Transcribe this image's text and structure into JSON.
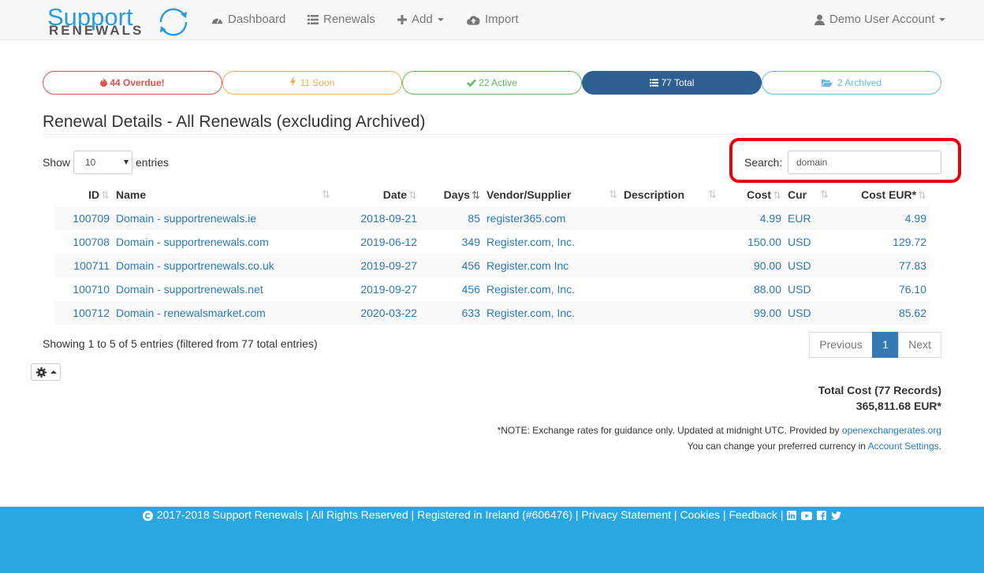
{
  "brand": {
    "line1": "Support",
    "line2": "RENEWALS"
  },
  "nav": {
    "dashboard": "Dashboard",
    "renewals": "Renewals",
    "add": "Add",
    "import": "Import",
    "account": "Demo User Account"
  },
  "status_tabs": {
    "overdue": "44 Overdue!",
    "soon": "11 Soon",
    "active": "22 Active",
    "total": "77 Total",
    "archived": "2 Archived"
  },
  "colors": {
    "overdue": "#d9534f",
    "soon": "#f0ad4e",
    "active": "#5cb85c",
    "total": "#2d5f91",
    "archived": "#5bc0de",
    "footer": "#29a8e0"
  },
  "page_title": "Renewal Details - All Renewals (excluding Archived)",
  "length": {
    "show": "Show",
    "value": "10",
    "entries": "entries"
  },
  "search": {
    "label": "Search:",
    "value": "domain"
  },
  "table": {
    "headers": {
      "id": "ID",
      "name": "Name",
      "date": "Date",
      "days": "Days",
      "vendor": "Vendor/Supplier",
      "description": "Description",
      "cost": "Cost",
      "cur": "Cur",
      "cost_eur": "Cost EUR*"
    },
    "rows": [
      {
        "id": "100709",
        "name": "Domain - supportrenewals.ie",
        "date": "2018-09-21",
        "days": "85",
        "vendor": "register365.com",
        "description": "",
        "cost": "4.99",
        "cur": "EUR",
        "cost_eur": "4.99"
      },
      {
        "id": "100708",
        "name": "Domain - supportrenewals.com",
        "date": "2019-06-12",
        "days": "349",
        "vendor": "Register.com, Inc.",
        "description": "",
        "cost": "150.00",
        "cur": "USD",
        "cost_eur": "129.72"
      },
      {
        "id": "100711",
        "name": "Domain - supportrenewals.co.uk",
        "date": "2019-09-27",
        "days": "456",
        "vendor": "Register.com Inc",
        "description": "",
        "cost": "90.00",
        "cur": "USD",
        "cost_eur": "77.83"
      },
      {
        "id": "100710",
        "name": "Domain - supportrenewals.net",
        "date": "2019-09-27",
        "days": "456",
        "vendor": "Register.com, Inc.",
        "description": "",
        "cost": "88.00",
        "cur": "USD",
        "cost_eur": "76.10"
      },
      {
        "id": "100712",
        "name": "Domain - renewalsmarket.com",
        "date": "2020-03-22",
        "days": "633",
        "vendor": "Register.com, Inc.",
        "description": "",
        "cost": "99.00",
        "cur": "USD",
        "cost_eur": "85.62"
      }
    ]
  },
  "info": "Showing 1 to 5 of 5 entries (filtered from 77 total entries)",
  "pagination": {
    "previous": "Previous",
    "page": "1",
    "next": "Next"
  },
  "totals": {
    "label": "Total Cost (77 Records)",
    "value": "365,811.68 EUR*"
  },
  "note": {
    "line1": "*NOTE: Exchange rates for guidance only. Updated at midnight UTC. Provided by ",
    "link1": "openexchangerates.org",
    "line2": "You can change your preferred currency in ",
    "link2": "Account Settings",
    "end": "."
  },
  "footer": {
    "copyright": "2017-2018 Support Renewals | All Rights Reserved | Registered in Ireland (#606476) | ",
    "privacy": "Privacy Statement",
    "sep1": " | ",
    "cookies": "Cookies",
    "sep2": " | ",
    "feedback": "Feedback",
    "sep3": " | "
  }
}
